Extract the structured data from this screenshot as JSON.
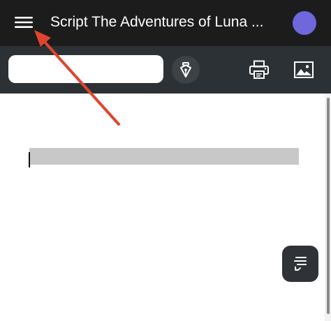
{
  "header": {
    "title": "Script The Adventures of Luna ...",
    "menu_icon": "hamburger-menu-icon",
    "avatar_color": "#6e68dc",
    "background": "#1c1c1c"
  },
  "toolbar": {
    "search_value": "",
    "pen_icon": "fountain-pen-icon",
    "print_icon": "printer-icon",
    "image_icon": "image-icon",
    "background": "#2c3135"
  },
  "document": {
    "highlight_color": "#c8c8c8"
  },
  "fab": {
    "icon": "screenplay-format-icon"
  },
  "annotation": {
    "arrow_color": "#e0442e"
  }
}
